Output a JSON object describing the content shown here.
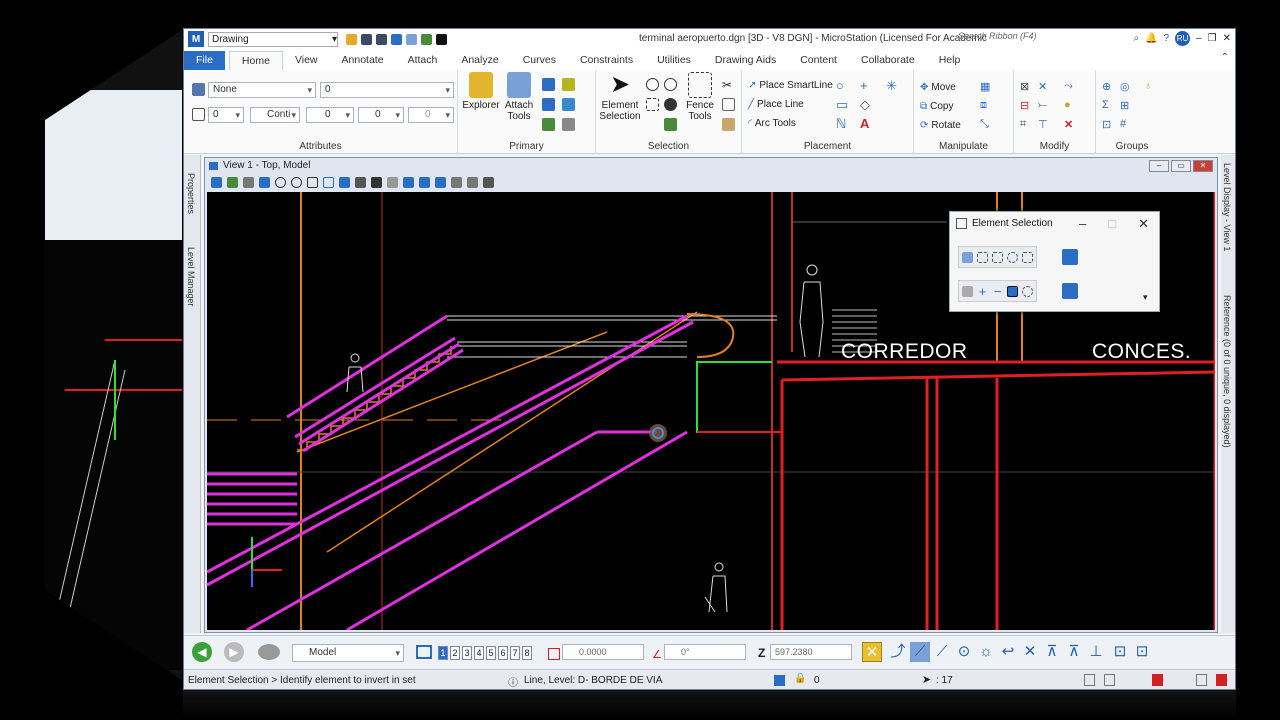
{
  "titlebar": {
    "workspace": "Drawing",
    "title": "terminal aeropuerto.dgn [3D - V8 DGN] - MicroStation (Licensed For Academic",
    "search_placeholder": "Search Ribbon (F4)",
    "user_initials": "RU"
  },
  "tabs": [
    "File",
    "Home",
    "View",
    "Annotate",
    "Attach",
    "Analyze",
    "Curves",
    "Constraints",
    "Utilities",
    "Drawing Aids",
    "Content",
    "Collaborate",
    "Help"
  ],
  "ribbon": {
    "attributes": {
      "label": "Attributes",
      "level": "None",
      "color": "0",
      "weight": "0",
      "style": "Conti",
      "line_weight": "0",
      "transparency": "0",
      "priority": "0"
    },
    "primary": {
      "label": "Primary",
      "explorer": "Explorer",
      "attach_tools": "Attach Tools"
    },
    "selection": {
      "label": "Selection",
      "element_selection": "Element Selection",
      "fence_tools": "Fence Tools"
    },
    "placement": {
      "label": "Placement",
      "smartline": "Place SmartLine",
      "line": "Place Line",
      "arc": "Arc Tools"
    },
    "manipulate": {
      "label": "Manipulate",
      "move": "Move",
      "copy": "Copy",
      "rotate": "Rotate"
    },
    "modify": {
      "label": "Modify"
    },
    "groups": {
      "label": "Groups"
    }
  },
  "side_tabs": [
    "Properties",
    "Level Manager"
  ],
  "right_tabs": [
    "Level Display - View 1",
    "Reference (0 of 0 unique, 0 displayed)"
  ],
  "view": {
    "title": "View 1 - Top, Model"
  },
  "canvas_labels": {
    "corredor": "CORREDOR",
    "conces": "CONCES."
  },
  "element_selection": {
    "title": "Element Selection"
  },
  "bottombar": {
    "model": "Model",
    "views": [
      "1",
      "2",
      "3",
      "4",
      "5",
      "6",
      "7",
      "8"
    ],
    "x_value": "0.0000",
    "angle_value": "0°",
    "z_label": "Z",
    "z_value": "597.2380"
  },
  "statusbar": {
    "prompt": "Element Selection > Identify element to invert in set",
    "element_info": "Line, Level: D- BORDE DE VIA",
    "active_value": "0",
    "selected_count": ": 17"
  },
  "colors": {
    "magenta": "#e030e0",
    "red": "#e02020",
    "orange": "#e08020",
    "green": "#30e030",
    "accent": "#2b6cc4"
  }
}
